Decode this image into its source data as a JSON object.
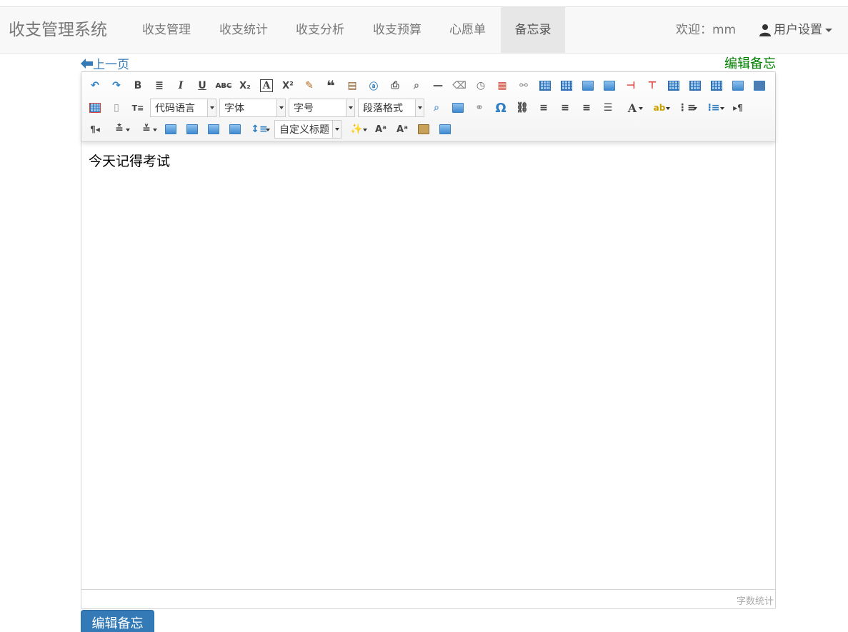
{
  "nav": {
    "brand": "收支管理系统",
    "links": [
      "收支管理",
      "收支统计",
      "收支分析",
      "收支预算",
      "心愿单",
      "备忘录"
    ],
    "active_index": 5,
    "welcome": "欢迎：mm",
    "user_settings": "用户设置"
  },
  "page": {
    "back_label": "上一页",
    "heading": "编辑备忘"
  },
  "toolbar": {
    "code_language": "代码语言",
    "font_family": "字体",
    "font_size": "字号",
    "paragraph_format": "段落格式",
    "custom_title": "自定义标题"
  },
  "editor": {
    "content": "今天记得考试",
    "word_count_label": "字数统计"
  },
  "form": {
    "submit_label": "编辑备忘"
  },
  "colors": {
    "navbar_bg": "#f8f8f8",
    "link_blue": "#337ab7",
    "heading_green": "#008000",
    "button_blue": "#337ab7"
  }
}
